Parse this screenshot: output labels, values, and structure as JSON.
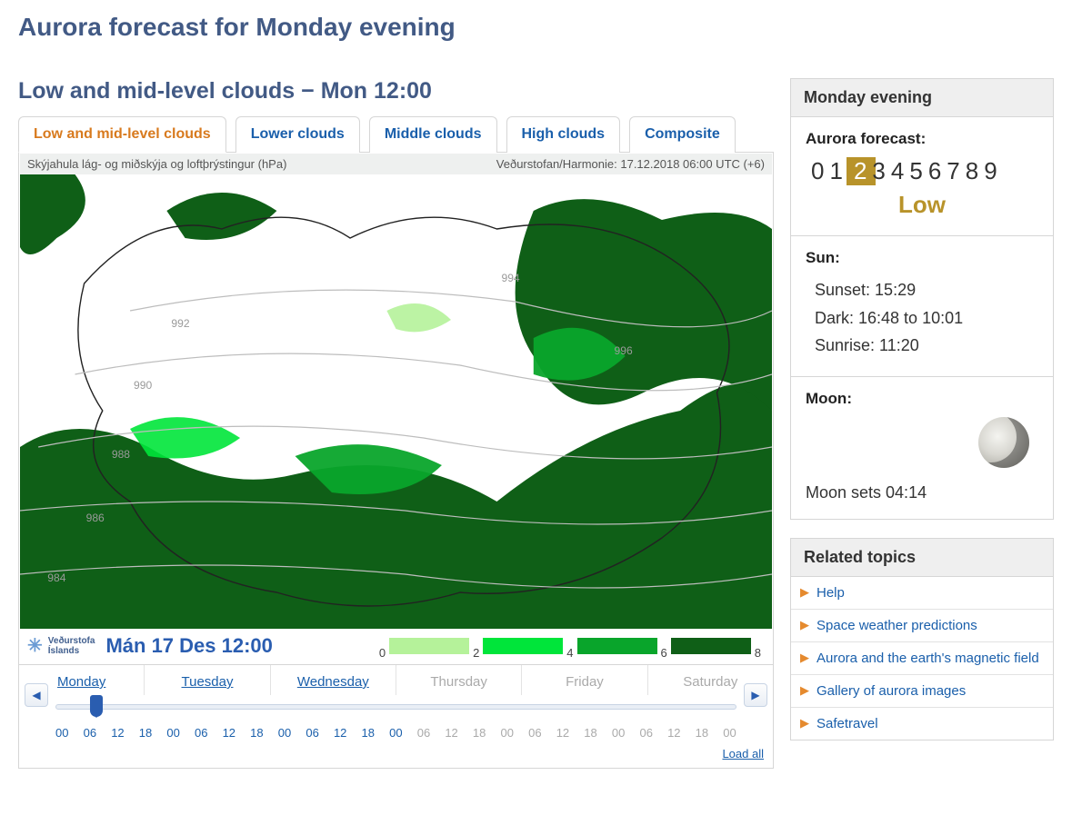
{
  "page_title": "Aurora forecast for Monday evening",
  "section_title": "Low and mid-level clouds − Mon 12:00",
  "tabs": [
    "Low and mid-level clouds",
    "Lower clouds",
    "Middle clouds",
    "High clouds",
    "Composite"
  ],
  "active_tab_index": 0,
  "map": {
    "header_left": "Skýjahula lág- og miðskýja og loftþrýstingur (hPa)",
    "header_right": "Veðurstofan/Harmonie: 17.12.2018 06:00 UTC (+6)",
    "logo_line1": "Veðurstofa",
    "logo_line2": "Íslands",
    "time_caption": "Mán 17 Des 12:00",
    "legend_ticks": [
      "0",
      "2",
      "4",
      "6",
      "8"
    ],
    "legend_colors": [
      "#b5f29a",
      "#00e53a",
      "#09a52b",
      "#0f5f17"
    ],
    "isobar_labels": [
      "984",
      "986",
      "988",
      "990",
      "992",
      "994",
      "996"
    ]
  },
  "timeline": {
    "days": [
      {
        "label": "Monday",
        "link": true
      },
      {
        "label": "Tuesday",
        "link": true
      },
      {
        "label": "Wednesday",
        "link": true
      },
      {
        "label": "Thursday",
        "link": false
      },
      {
        "label": "Friday",
        "link": false
      },
      {
        "label": "Saturday",
        "link": false
      }
    ],
    "hours": [
      "00",
      "06",
      "12",
      "18",
      "00",
      "06",
      "12",
      "18",
      "00",
      "06",
      "12",
      "18",
      "00",
      "06",
      "12",
      "18",
      "00",
      "06",
      "12",
      "18",
      "00",
      "06",
      "12",
      "18",
      "00"
    ],
    "hour_active_cutoff": 12,
    "load_all": "Load all"
  },
  "sidebar": {
    "panel_title": "Monday evening",
    "forecast_label": "Aurora forecast:",
    "scale_digits": [
      "0",
      "1",
      "2",
      "3",
      "4",
      "5",
      "6",
      "7",
      "8",
      "9"
    ],
    "scale_selected_index": 2,
    "scale_word": "Low",
    "sun_label": "Sun:",
    "sun_lines": [
      "Sunset: 15:29",
      "Dark: 16:48 to 10:01",
      "Sunrise: 11:20"
    ],
    "moon_label": "Moon:",
    "moon_text": "Moon sets 04:14",
    "related_title": "Related topics",
    "related_items": [
      "Help",
      "Space weather predictions",
      "Aurora and the earth's magnetic field",
      "Gallery of aurora images",
      "Safetravel"
    ]
  }
}
